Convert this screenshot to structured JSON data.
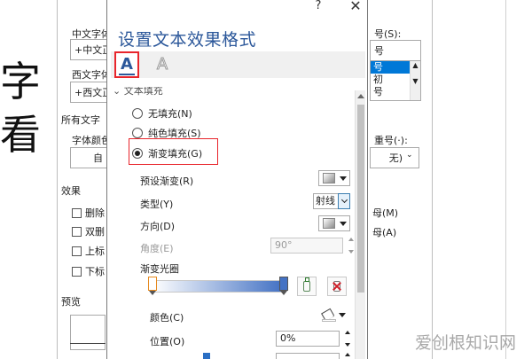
{
  "document": {
    "glyph": "字看"
  },
  "font_dialog": {
    "chinese_font_label": "中文字体",
    "chinese_font_value": "+中文正",
    "western_font_label": "西文字体",
    "western_font_value": "+西文正",
    "all_text_label": "所有文字",
    "font_color_label": "字体颜色",
    "font_color_value": "自",
    "size_label": "号(S):",
    "size_value": "号",
    "size_options": [
      "号",
      "初",
      "号"
    ],
    "emphasis_label": "重号(·):",
    "emphasis_value": "无)",
    "effects_label": "效果",
    "effects_checks": [
      "删除",
      "双删",
      "上标",
      "下标"
    ],
    "effects_right": [
      "母(M)",
      "母(A)"
    ],
    "preview_label": "预览"
  },
  "pane": {
    "help": "?",
    "close": "✕",
    "title": "设置文本效果格式",
    "tabs": {
      "fill_icon": "text-fill-outline-icon",
      "effects_icon": "text-effects-icon",
      "glyph": "A"
    },
    "section_header": "文本填充",
    "fill_options": {
      "none": "无填充(N)",
      "solid": "纯色填充(S)",
      "gradient": "渐变填充(G)"
    },
    "preset_label": "预设渐变(R)",
    "type_label": "类型(Y)",
    "type_value": "射线",
    "direction_label": "方向(D)",
    "angle_label": "角度(E)",
    "angle_value": "90°",
    "stops_label": "渐变光圈",
    "color_label": "颜色(C)",
    "position_label": "位置(O)",
    "position_value": "0%"
  },
  "watermark": "爱创根知识网",
  "colors": {
    "accent_title": "#2b579a",
    "highlight_red": "#e8252b",
    "gradient_end": "#4472c4"
  }
}
